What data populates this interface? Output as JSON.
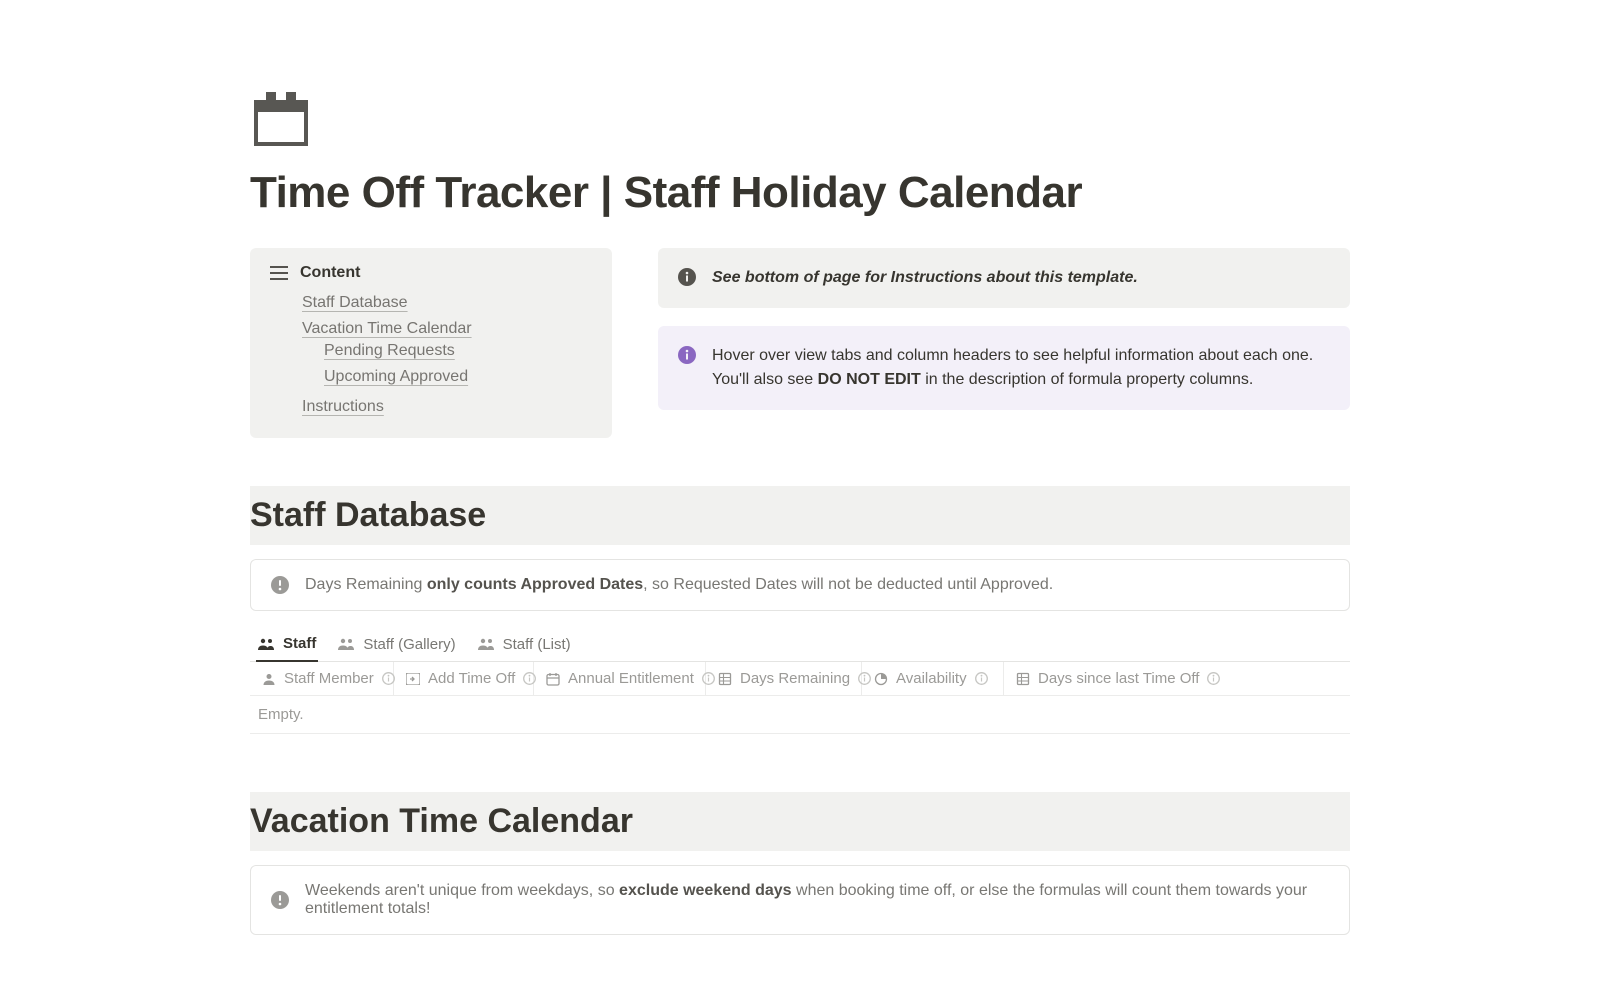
{
  "page": {
    "title": "Time Off Tracker | Staff Holiday Calendar"
  },
  "toc": {
    "label": "Content",
    "items": {
      "staff_db": "Staff Database",
      "vac_cal": "Vacation Time Calendar",
      "pending": "Pending Requests",
      "upcoming": "Upcoming Approved",
      "instructions": "Instructions"
    }
  },
  "callouts": {
    "see_bottom": "See bottom of page for Instructions about this template.",
    "hover_pre": "Hover over view tabs and column headers to see helpful information about each one. You'll also see ",
    "do_not_edit": "DO NOT EDIT",
    "hover_post": " in the description of formula property columns."
  },
  "staff_db": {
    "heading": "Staff Database",
    "warn_pre": "Days Remaining ",
    "warn_bold": "only counts Approved Dates",
    "warn_post": ", so Requested Dates will not be deducted until Approved.",
    "tabs": {
      "staff": "Staff",
      "gallery": "Staff (Gallery)",
      "list": "Staff (List)"
    },
    "cols": {
      "member": "Staff Member",
      "add": "Add Time Off",
      "annual": "Annual Entitlement",
      "remaining": "Days Remaining",
      "availability": "Availability",
      "since": "Days since last Time Off"
    },
    "empty": "Empty."
  },
  "vac_cal": {
    "heading": "Vacation Time Calendar",
    "warn_pre": "Weekends aren't unique from weekdays, so ",
    "warn_bold": "exclude weekend days",
    "warn_post": " when booking time off, or else the formulas will count them towards your entitlement totals!"
  }
}
